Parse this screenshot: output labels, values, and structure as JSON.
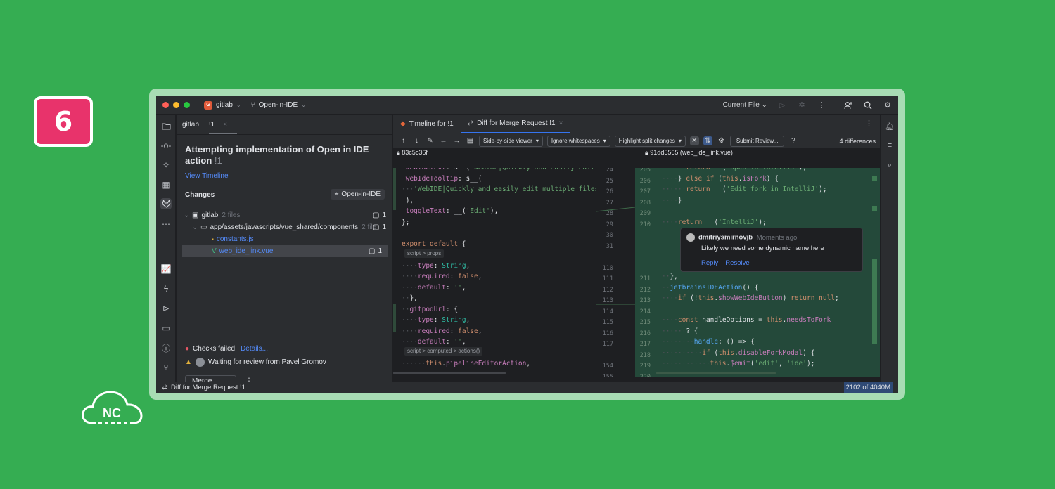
{
  "badge": "6",
  "logo_text": "NC",
  "title_bar": {
    "project_initial": "G",
    "project": "gitlab",
    "branch": "Open-in-IDE",
    "run_config": "Current File"
  },
  "left_panel": {
    "tab1": "gitlab",
    "tab2": "!1",
    "title": "Attempting implementation of Open in IDE action",
    "title_num": "!1",
    "view_timeline": "View Timeline",
    "changes_label": "Changes",
    "branch_chip": "Open-in-IDE",
    "tree": [
      {
        "label": "gitlab",
        "extra": "2 files",
        "count": "1"
      },
      {
        "label": "app/assets/javascripts/vue_shared/components",
        "extra": "2 file",
        "count": "1"
      },
      {
        "label": "constants.js",
        "extra": "",
        "count": ""
      },
      {
        "label": "web_ide_link.vue",
        "extra": "",
        "count": "1"
      }
    ],
    "checks_failed": "Checks failed",
    "details": "Details...",
    "waiting": "Waiting for review from Pavel Gromov",
    "merge_button": "Merge..."
  },
  "right_panel": {
    "tabs": [
      {
        "label": "Timeline for !1"
      },
      {
        "label": "Diff for Merge Request !1"
      }
    ],
    "viewer": "Side-by-side viewer",
    "whitespace": "Ignore whitespaces",
    "highlight": "Highlight split changes",
    "submit": "Submit Review...",
    "differences": "4 differences",
    "left_hash": "83c5c36f",
    "right_hash": "91dd5565 (web_ide_link.vue)",
    "crumb1": "script > props",
    "crumb2": "script > computed > actions()",
    "left_gutter": [
      "24",
      "25",
      "26",
      "27",
      "28",
      "29",
      "30",
      "31",
      "",
      "110",
      "111",
      "112",
      "113",
      "114",
      "115",
      "116",
      "117",
      "",
      "154",
      "155"
    ],
    "right_gutter": [
      "205",
      "206",
      "207",
      "208",
      "209",
      "210",
      "",
      "",
      "",
      "",
      "211",
      "212",
      "213",
      "214",
      "215",
      "216",
      "217",
      "218",
      "219",
      "220"
    ],
    "comment": {
      "author": "dmitriysmirnovjb",
      "time": "Moments ago",
      "text": "Likely we need some dynamic name here",
      "reply": "Reply",
      "resolve": "Resolve"
    }
  },
  "status_bar": {
    "text": "Diff for Merge Request !1",
    "memory": "2102 of 4040M"
  }
}
